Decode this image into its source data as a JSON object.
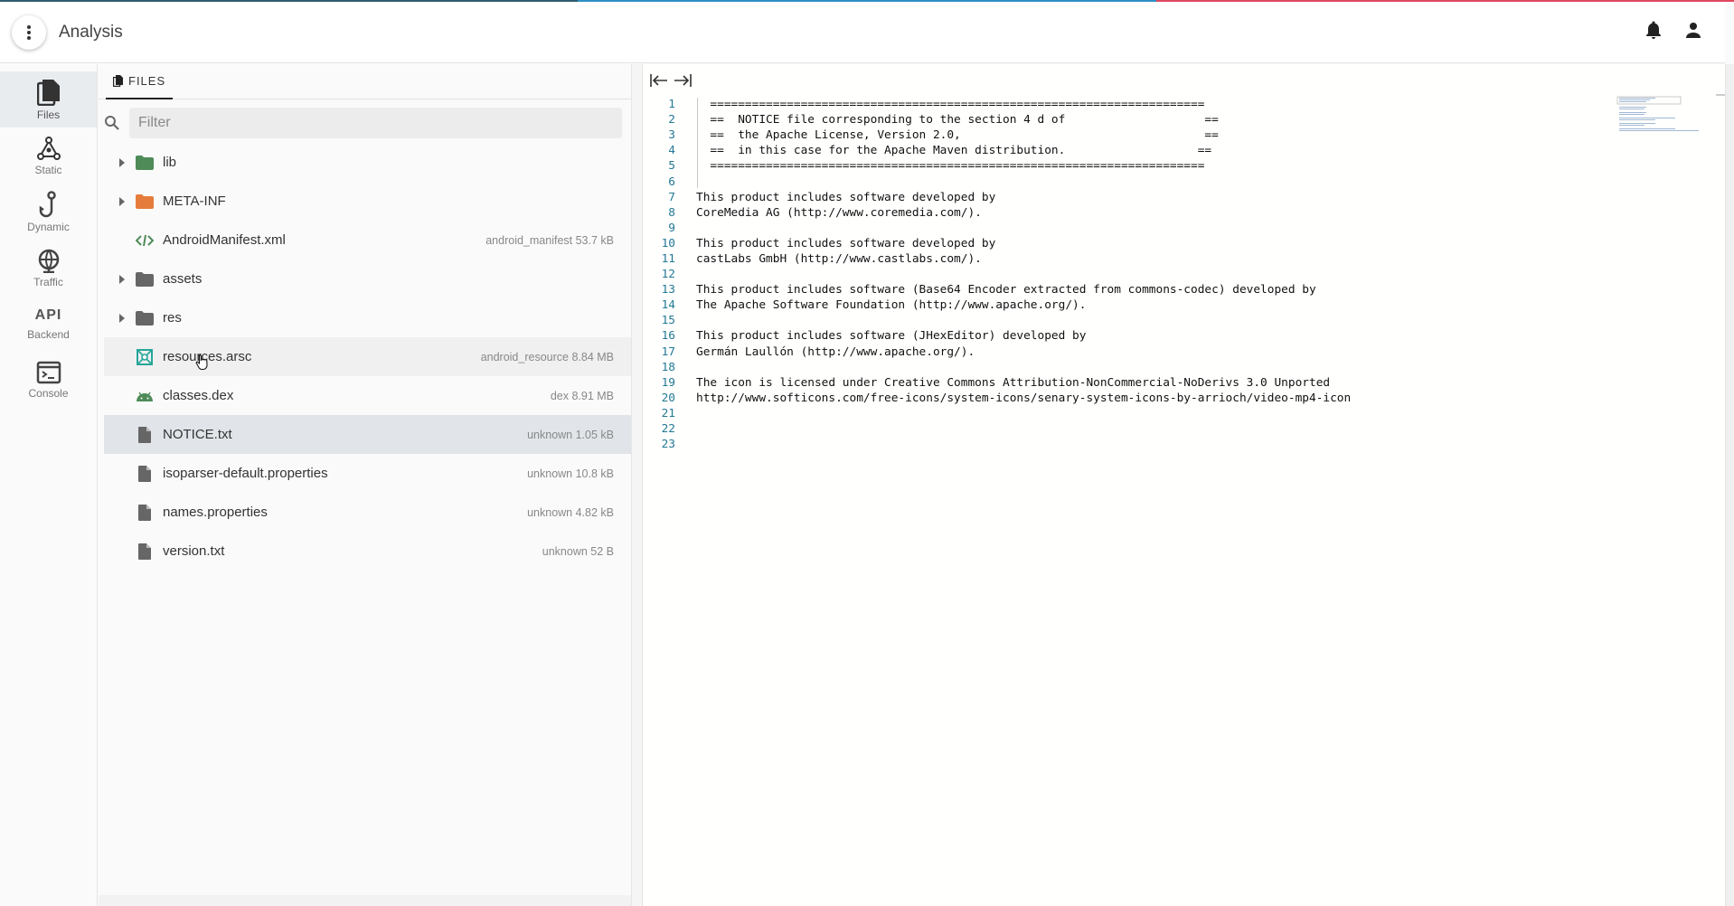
{
  "app": {
    "title": "Analysis",
    "topline_colors": [
      "#2e5c6e",
      "#2f8fc6",
      "#e0485e"
    ]
  },
  "header": {
    "menu_icon": "more-vert-icon",
    "notifications_icon": "bell-icon",
    "account_icon": "person-icon"
  },
  "sidebar": {
    "items": [
      {
        "label": "Files",
        "icon": "files-icon",
        "active": true
      },
      {
        "label": "Static",
        "icon": "graph-icon"
      },
      {
        "label": "Dynamic",
        "icon": "hook-icon"
      },
      {
        "label": "Traffic",
        "icon": "globe-icon"
      },
      {
        "label": "Backend",
        "icon": "api-icon",
        "glyph": "API"
      },
      {
        "label": "Console",
        "icon": "terminal-icon"
      }
    ]
  },
  "files_panel": {
    "tab_label": "FILES",
    "filter_placeholder": "Filter",
    "tree": [
      {
        "name": "lib",
        "type": "folder",
        "color": "#4e8b59",
        "expandable": true
      },
      {
        "name": "META-INF",
        "type": "folder",
        "color": "#e67c3c",
        "expandable": true
      },
      {
        "name": "AndroidManifest.xml",
        "type": "code",
        "meta": "android_manifest 53.7 kB"
      },
      {
        "name": "assets",
        "type": "folder",
        "color": "#666666",
        "expandable": true
      },
      {
        "name": "res",
        "type": "folder",
        "color": "#666666",
        "expandable": true
      },
      {
        "name": "resources.arsc",
        "type": "resource",
        "meta": "android_resource 8.84 MB"
      },
      {
        "name": "classes.dex",
        "type": "android",
        "meta": "dex 8.91 MB"
      },
      {
        "name": "NOTICE.txt",
        "type": "file",
        "meta": "unknown 1.05 kB",
        "selected": true
      },
      {
        "name": "isoparser-default.properties",
        "type": "file",
        "meta": "unknown 10.8 kB"
      },
      {
        "name": "names.properties",
        "type": "file",
        "meta": "unknown 4.82 kB"
      },
      {
        "name": "version.txt",
        "type": "file",
        "meta": "unknown 52 B"
      }
    ]
  },
  "editor": {
    "lines": [
      "  =======================================================================",
      "  ==  NOTICE file corresponding to the section 4 d of                    ==",
      "  ==  the Apache License, Version 2.0,                                   ==",
      "  ==  in this case for the Apache Maven distribution.                   ==",
      "  =======================================================================",
      "",
      "This product includes software developed by",
      "CoreMedia AG (http://www.coremedia.com/).",
      "",
      "This product includes software developed by",
      "castLabs GmbH (http://www.castlabs.com/).",
      "",
      "This product includes software (Base64 Encoder extracted from commons-codec) developed by",
      "The Apache Software Foundation (http://www.apache.org/).",
      "",
      "This product includes software (JHexEditor) developed by",
      "Germán Laullón (http://www.apache.org/).",
      "",
      "The icon is licensed under Creative Commons Attribution-NonCommercial-NoDerivs 3.0 Unported",
      "http://www.softicons.com/free-icons/system-icons/senary-system-icons-by-arrioch/video-mp4-icon",
      "",
      "",
      ""
    ]
  }
}
